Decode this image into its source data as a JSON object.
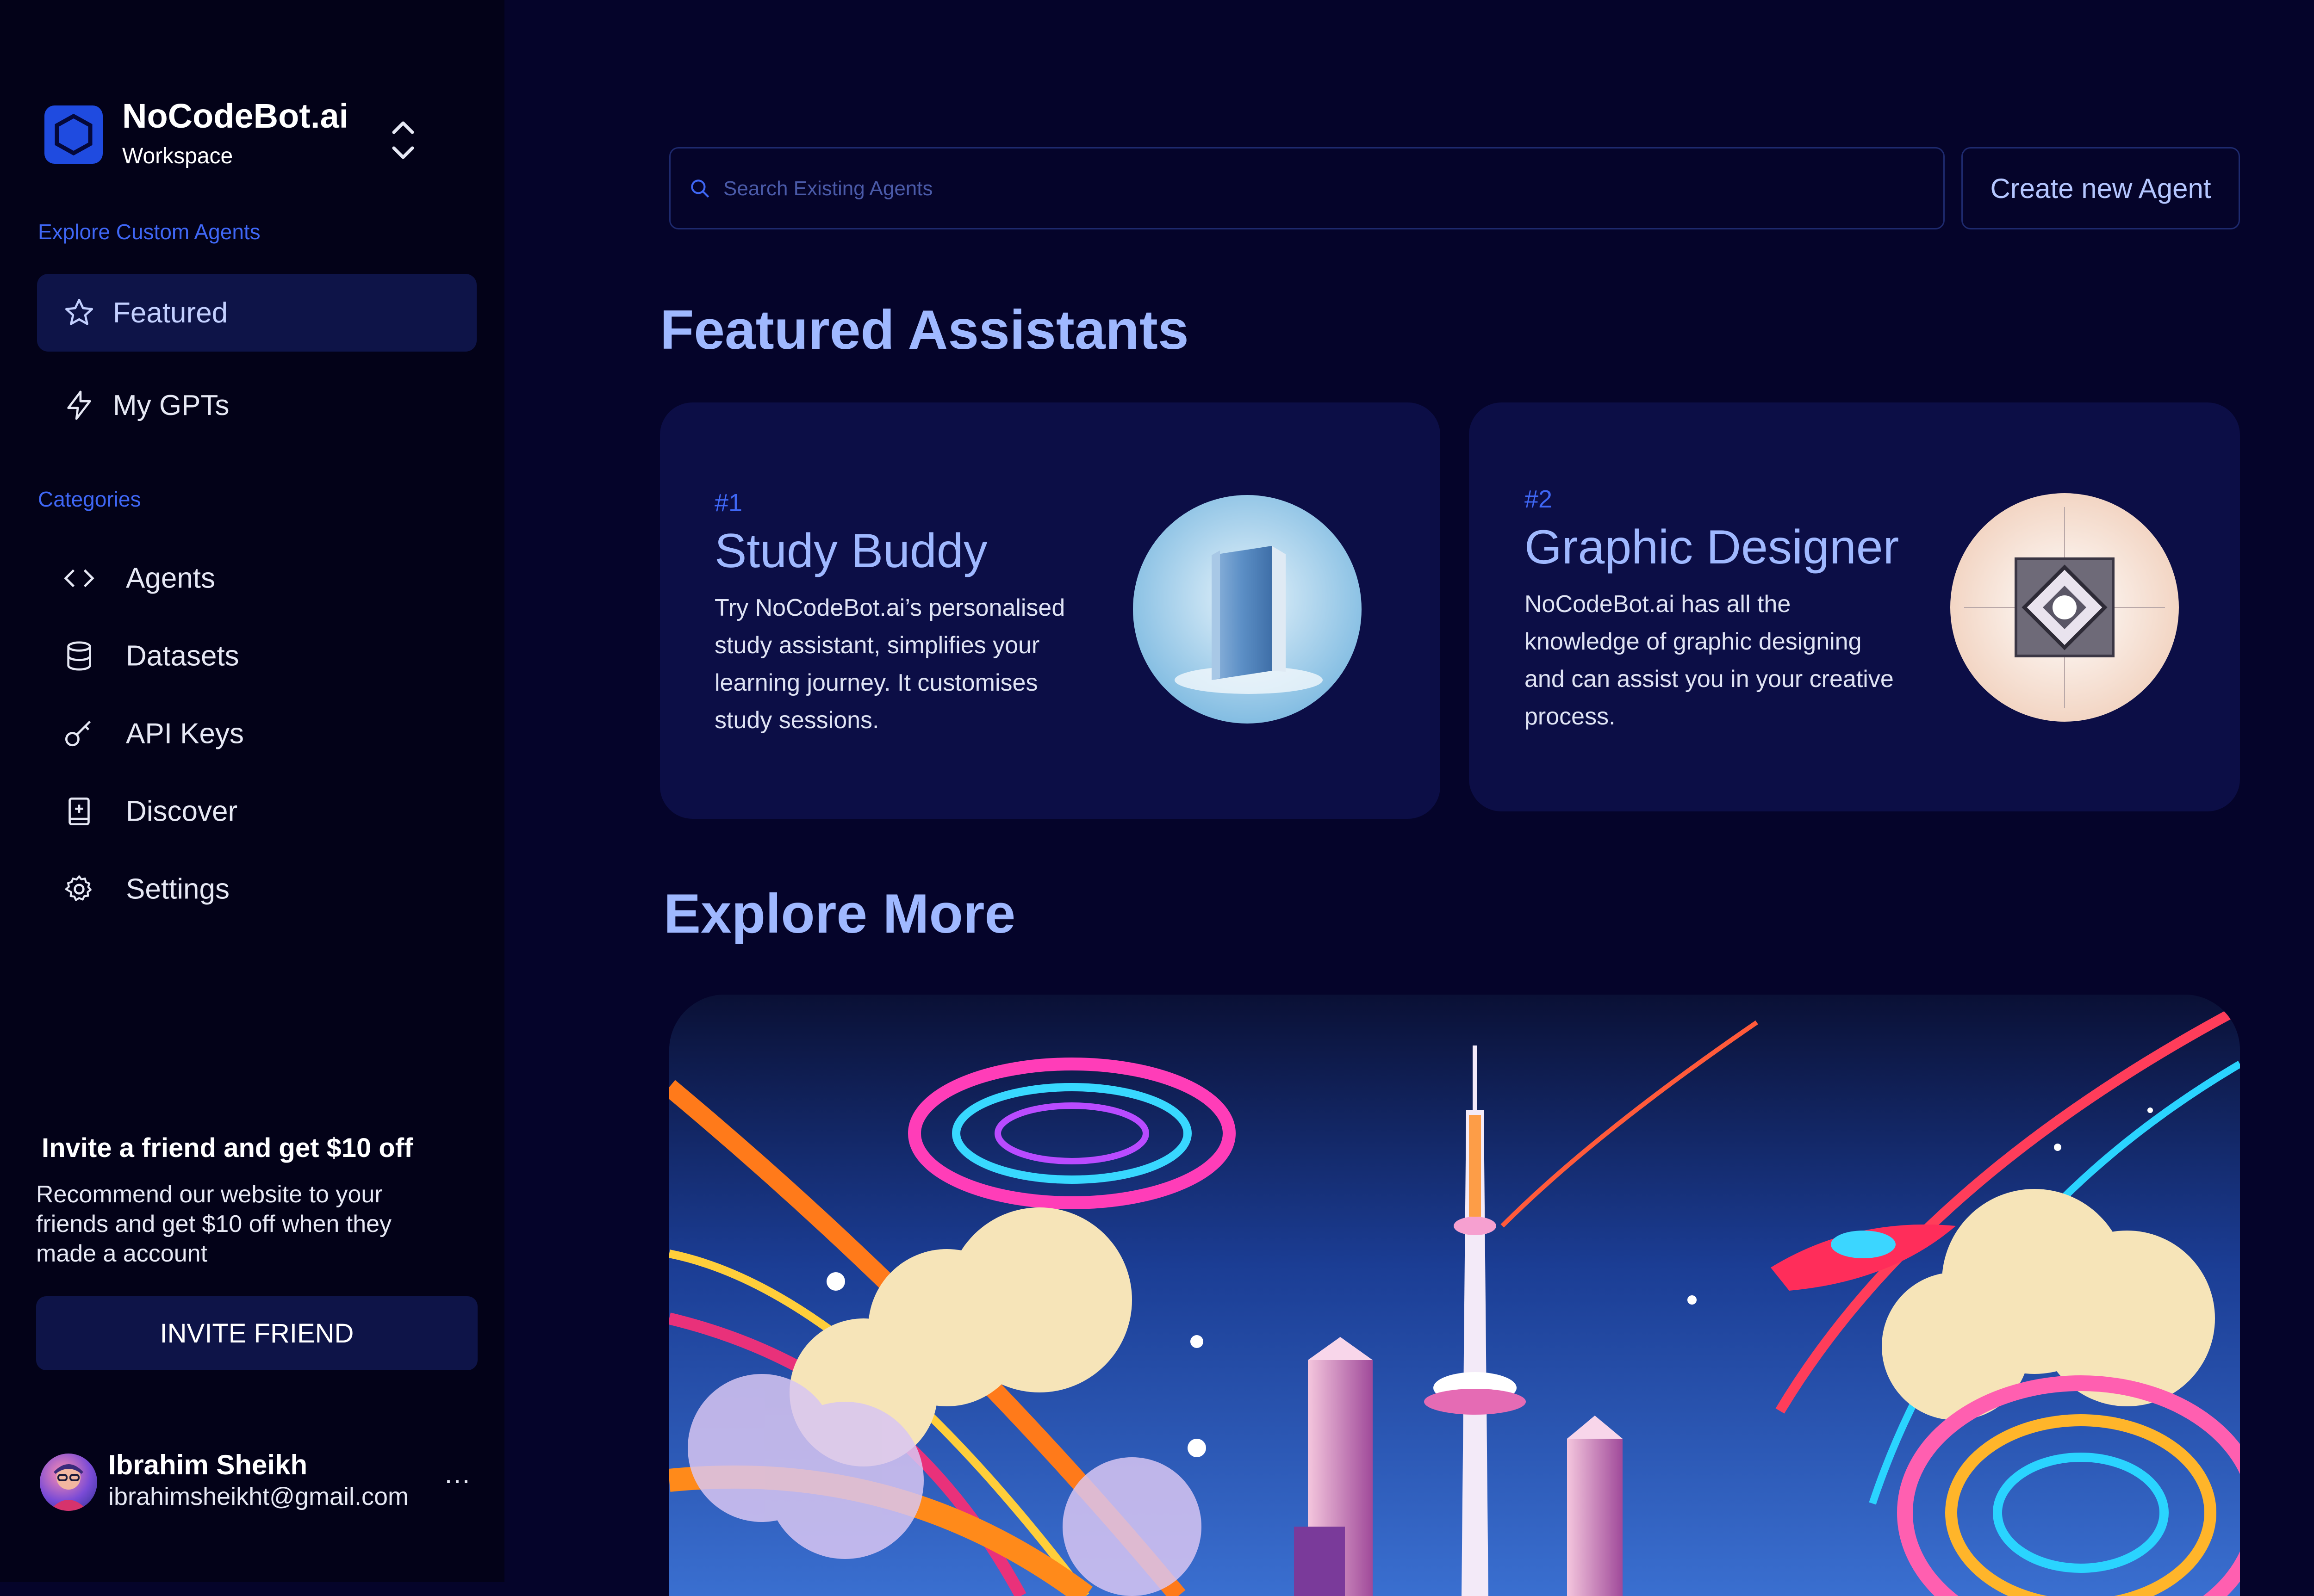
{
  "workspace": {
    "name": "NoCodeBot.ai",
    "subtitle": "Workspace"
  },
  "sidebar": {
    "explore_label": "Explore Custom Agents",
    "nav": [
      {
        "label": "Featured",
        "icon": "star-icon",
        "active": true
      },
      {
        "label": "My GPTs",
        "icon": "lightning-icon",
        "active": false
      }
    ],
    "categories_label": "Categories",
    "categories": [
      {
        "label": "Agents",
        "icon": "code-icon"
      },
      {
        "label": "Datasets",
        "icon": "database-icon"
      },
      {
        "label": "API Keys",
        "icon": "key-icon"
      },
      {
        "label": "Discover",
        "icon": "book-plus-icon"
      },
      {
        "label": "Settings",
        "icon": "gear-icon"
      }
    ],
    "invite": {
      "title": "Invite a friend and get $10 off",
      "text": "Recommend our website to your friends and get $10 off when they made a account",
      "button": "INVITE FRIEND"
    },
    "user": {
      "name": "Ibrahim Sheikh",
      "email": "ibrahimsheikht@gmail.com",
      "more": "…"
    }
  },
  "header": {
    "search_placeholder": "Search Existing Agents",
    "search_value": "",
    "create_button": "Create new Agent"
  },
  "featured": {
    "heading": "Featured Assistants",
    "cards": [
      {
        "rank": "#1",
        "title": "Study Buddy",
        "description": "Try NoCodeBot.ai’s personalised study assistant, simplifies your learning journey. It customises study sessions.",
        "image": "book-illustration"
      },
      {
        "rank": "#2",
        "title": "Graphic Designer",
        "description": "NoCodeBot.ai has all the knowledge of graphic designing and can assist you in your creative process.",
        "image": "geometric-design-illustration"
      }
    ]
  },
  "explore": {
    "heading": "Explore More",
    "image": "futuristic-city-banner"
  },
  "colors": {
    "background": "#05042a",
    "sidebar": "#030218",
    "accent": "#3f67f5",
    "heading": "#9fb8ff",
    "card": "#0c0e46"
  }
}
